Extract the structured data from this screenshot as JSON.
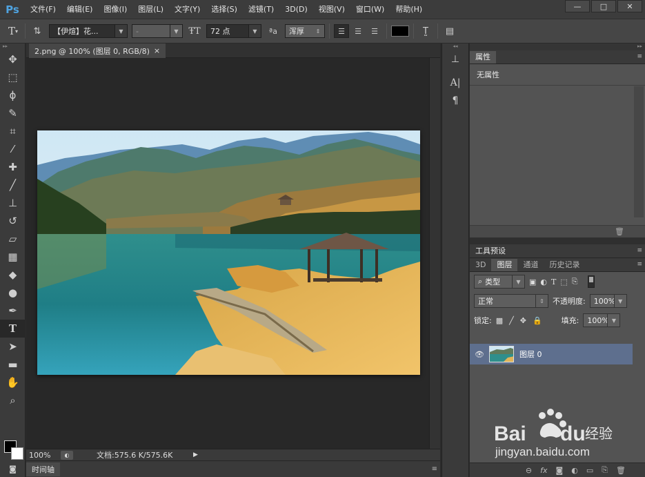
{
  "app": {
    "logo": "Ps"
  },
  "menu": [
    "文件(F)",
    "编辑(E)",
    "图像(I)",
    "图层(L)",
    "文字(Y)",
    "选择(S)",
    "滤镜(T)",
    "3D(D)",
    "视图(V)",
    "窗口(W)",
    "帮助(H)"
  ],
  "window_buttons": {
    "minimize": "—",
    "restore": "□",
    "close": "✕"
  },
  "options": {
    "font_family": "【伊煊】花...",
    "font_style": "-",
    "font_size": "72 点",
    "antialias": "浑厚",
    "color_hex": "#000000"
  },
  "document": {
    "tab_title": "2.png @ 100% (图层 0, RGB/8)",
    "tab_close": "×",
    "zoom": "100%",
    "doc_size": "文档:575.6 K/575.6K"
  },
  "timeline": {
    "label": "时间轴"
  },
  "properties": {
    "tab": "属性",
    "empty_text": "无属性"
  },
  "tool_presets": {
    "tab": "工具预设"
  },
  "layers_panel": {
    "tabs": [
      "3D",
      "图层",
      "通道",
      "历史记录"
    ],
    "filter_kind": "类型",
    "blend_mode": "正常",
    "opacity_label": "不透明度:",
    "opacity_value": "100%",
    "lock_label": "锁定:",
    "fill_label": "填充:",
    "fill_value": "100%",
    "layer_name": "图层 0"
  },
  "watermark": {
    "brand_prefix": "Bai",
    "brand_suffix": "du",
    "brand_cn": "经验",
    "url": "jingyan.baidu.com"
  },
  "colors": {
    "accent": "#4fa3e0",
    "selected_layer": "#5e6f8e",
    "foreground": "#000000",
    "background": "#ffffff"
  }
}
